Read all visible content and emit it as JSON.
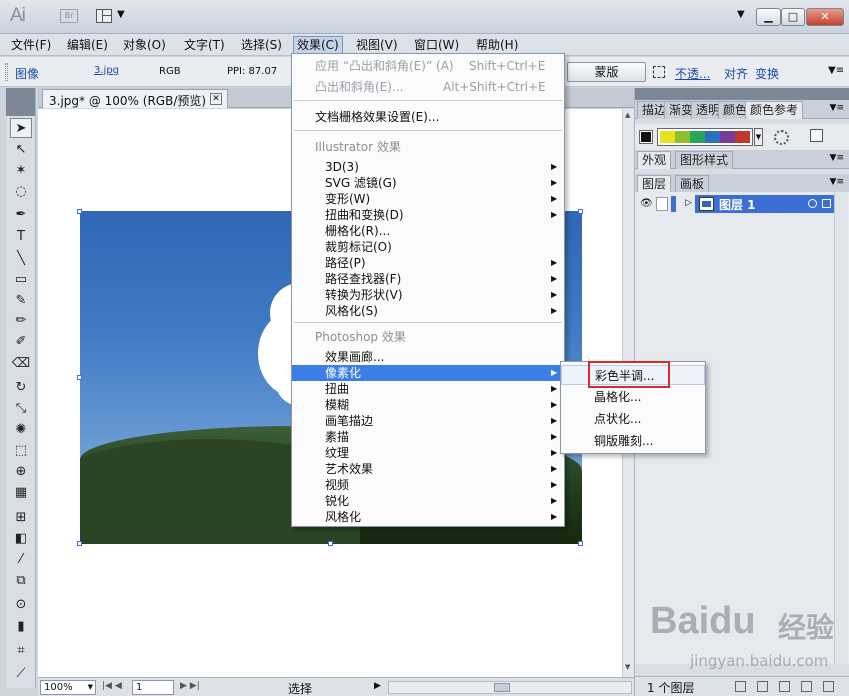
{
  "titlebar": {
    "logo": "Ai",
    "br": "Br"
  },
  "menubar": [
    "文件(F)",
    "编辑(E)",
    "对象(O)",
    "文字(T)",
    "选择(S)",
    "效果(C)",
    "视图(V)",
    "窗口(W)",
    "帮助(H)"
  ],
  "control": {
    "kind": "图像",
    "file": "3.jpg",
    "mode": "RGB",
    "ppi": "PPI: 87.07",
    "mask_button": "蒙版",
    "opacity": "不透...",
    "align": "对齐",
    "transform": "变换"
  },
  "document": {
    "tab_label": "3.jpg* @ 100% (RGB/预览)"
  },
  "status": {
    "zoom": "100%",
    "page": "1",
    "label": "选择"
  },
  "effect_menu": {
    "apply_last": "应用 “凸出和斜角(E)” (A)",
    "apply_last_shortcut": "Shift+Ctrl+E",
    "last_effect": "凸出和斜角(E)...",
    "last_effect_shortcut": "Alt+Shift+Ctrl+E",
    "raster_settings": "文档栅格效果设置(E)...",
    "illustrator_section": "Illustrator 效果",
    "illustrator_items": [
      "3D(3)",
      "SVG 滤镜(G)",
      "变形(W)",
      "扭曲和变换(D)",
      "栅格化(R)...",
      "裁剪标记(O)",
      "路径(P)",
      "路径查找器(F)",
      "转换为形状(V)",
      "风格化(S)"
    ],
    "photoshop_section": "Photoshop 效果",
    "photoshop_items": [
      "效果画廊...",
      "像素化",
      "扭曲",
      "模糊",
      "画笔描边",
      "素描",
      "纹理",
      "艺术效果",
      "视频",
      "锐化",
      "风格化"
    ]
  },
  "pixelate_menu": [
    "彩色半调...",
    "晶格化...",
    "点状化...",
    "铜版雕刻..."
  ],
  "panels": {
    "top_tabs": [
      "描边",
      "渐变",
      "透明",
      "颜色",
      "颜色参考"
    ],
    "mid_tabs": [
      "外观",
      "图形样式"
    ],
    "layer_tabs": [
      "图层",
      "画板"
    ],
    "layer_name": "图层 1",
    "layer_count": "1 个图层"
  },
  "swatch_colors": [
    "#e8e021",
    "#8fbf2c",
    "#2aa55a",
    "#2c6fc0",
    "#7a3c9a",
    "#c0392b"
  ],
  "watermark": {
    "logo": "Baidu",
    "jingyan": "经验",
    "url": "jingyan.baidu.com"
  }
}
